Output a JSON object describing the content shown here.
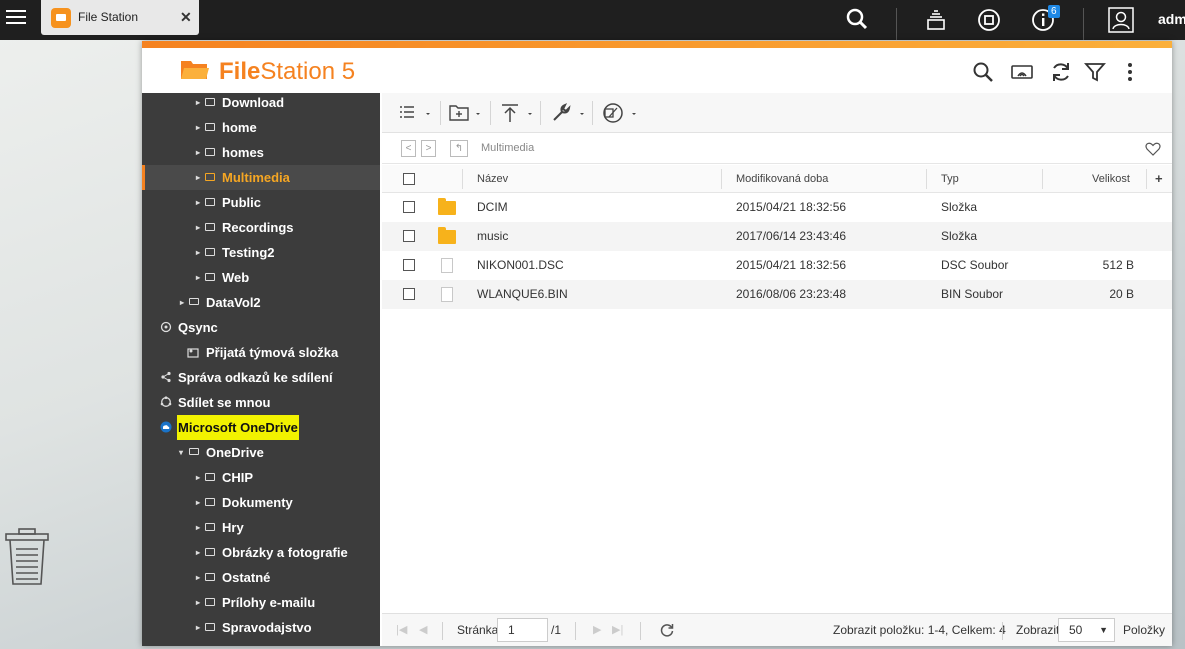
{
  "taskbar": {
    "app_tab_label": "File Station",
    "close_glyph": "✕",
    "notification_count": "6",
    "user_name": "admin"
  },
  "window": {
    "title_bold": "File",
    "title_rest": "Station 5"
  },
  "sidebar": {
    "items": [
      {
        "label": "Download"
      },
      {
        "label": "home"
      },
      {
        "label": "homes"
      },
      {
        "label": "Multimedia"
      },
      {
        "label": "Public"
      },
      {
        "label": "Recordings"
      },
      {
        "label": "Testing2"
      },
      {
        "label": "Web"
      },
      {
        "label": "DataVol2"
      },
      {
        "label": "Qsync"
      },
      {
        "label": "Přijatá týmová složka"
      },
      {
        "label": "Správa odkazů ke sdílení"
      },
      {
        "label": "Sdílet se mnou"
      },
      {
        "label": "Microsoft OneDrive"
      },
      {
        "label": "OneDrive"
      },
      {
        "label": "CHIP"
      },
      {
        "label": "Dokumenty"
      },
      {
        "label": "Hry"
      },
      {
        "label": "Obrázky a fotografie"
      },
      {
        "label": "Ostatné"
      },
      {
        "label": "Prílohy e-mailu"
      },
      {
        "label": "Spravodajstvo"
      }
    ]
  },
  "path": {
    "current": "Multimedia"
  },
  "table": {
    "headers": {
      "name": "Název",
      "modified": "Modifikovaná doba",
      "type": "Typ",
      "size": "Velikost",
      "add": "+"
    },
    "rows": [
      {
        "name": "DCIM",
        "modified": "2015/04/21 18:32:56",
        "type": "Složka",
        "size": ""
      },
      {
        "name": "music",
        "modified": "2017/06/14 23:43:46",
        "type": "Složka",
        "size": ""
      },
      {
        "name": "NIKON001.DSC",
        "modified": "2015/04/21 18:32:56",
        "type": "DSC Soubor",
        "size": "512 B"
      },
      {
        "name": "WLANQUE6.BIN",
        "modified": "2016/08/06 23:23:48",
        "type": "BIN Soubor",
        "size": "20 B"
      }
    ]
  },
  "footer": {
    "page_label": "Stránka",
    "page_value": "1",
    "page_total": "/1",
    "display_info": "Zobrazit položku: 1-4, Celkem: 4",
    "show_label": "Zobrazit",
    "per_page": "50",
    "items_label": "Položky"
  },
  "colors": {
    "accent": "#f58220",
    "sidebar_bg": "#3c3c3c",
    "highlight": "#f2f200",
    "folder": "#f7b21b"
  }
}
